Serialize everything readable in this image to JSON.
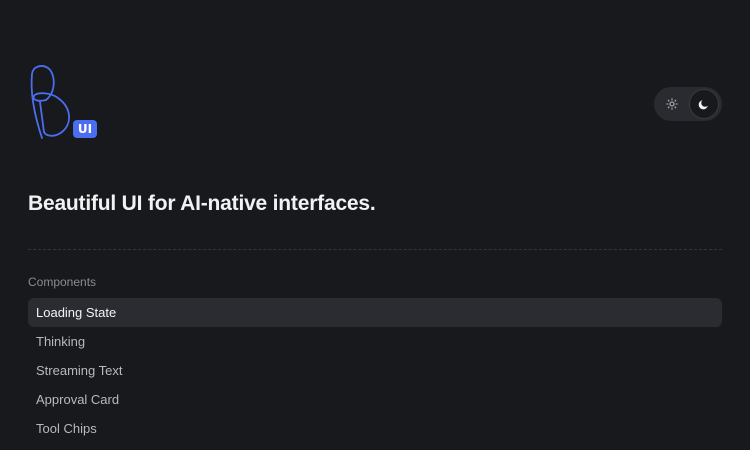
{
  "logo": {
    "badge_text": "UI",
    "brand_color": "#4b6ef0",
    "icon": "b-monogram-logo"
  },
  "theme_toggle": {
    "options": [
      {
        "name": "light",
        "icon": "sun-icon"
      },
      {
        "name": "dark",
        "icon": "moon-icon",
        "selected": true
      }
    ]
  },
  "hero": {
    "tagline": "Beautiful UI for AI-native interfaces."
  },
  "components_section": {
    "label": "Components",
    "items": [
      {
        "label": "Loading State",
        "active": true
      },
      {
        "label": "Thinking"
      },
      {
        "label": "Streaming Text"
      },
      {
        "label": "Approval Card"
      },
      {
        "label": "Tool Chips"
      }
    ]
  }
}
